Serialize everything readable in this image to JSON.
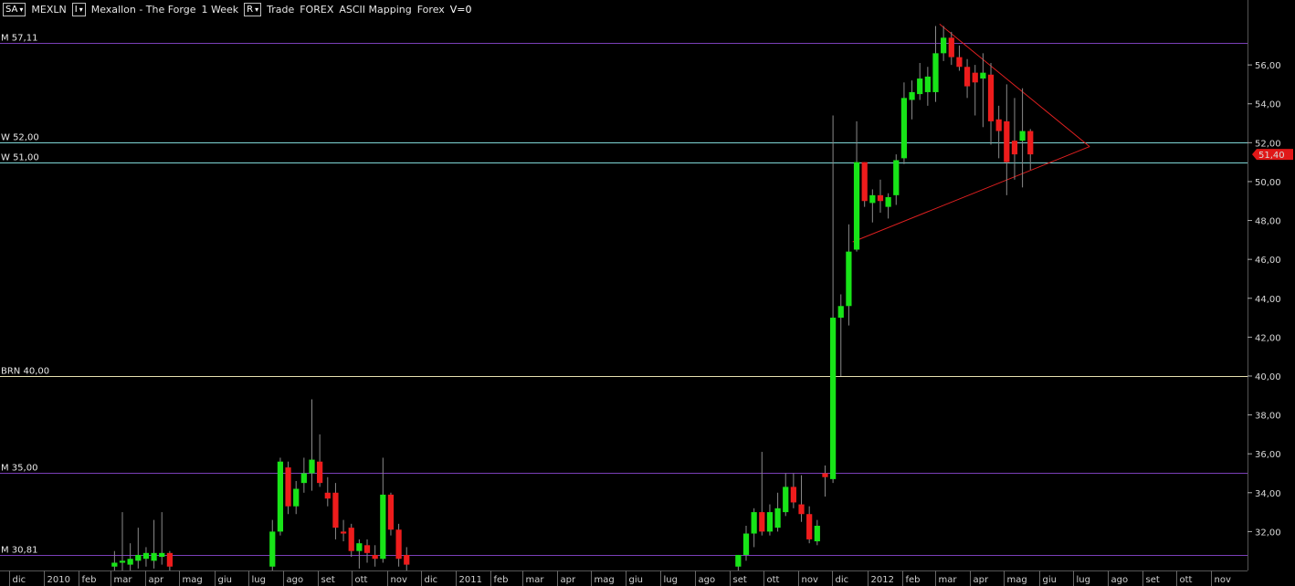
{
  "toolbar": {
    "source_box": "SA",
    "symbol": "MEXLN",
    "indicator_box": "I",
    "title": "Mexallon - The Forge",
    "period": "1 Week",
    "range_box": "R",
    "mode": "Trade",
    "market": "FOREX",
    "mapping": "ASCII Mapping",
    "category": "Forex",
    "volume": "V=0"
  },
  "colors": {
    "background": "#000000",
    "up_candle": "#18e418",
    "down_candle": "#ee1c1c",
    "wick": "#8a8a8a",
    "monthly_level": "#7a3fb8",
    "weekly_level": "#7fd6d6",
    "round_number_level": "#e6e0b0",
    "trendline": "#e02020",
    "price_tag": "#e01818"
  },
  "price_tag": {
    "label": "51,40",
    "value": 51.4
  },
  "chart_data": {
    "type": "candlestick",
    "ylim": [
      30.0,
      58.4
    ],
    "y_ticks": [
      {
        "value": 32,
        "label": "32,00"
      },
      {
        "value": 34,
        "label": "34,00"
      },
      {
        "value": 36,
        "label": "36,00"
      },
      {
        "value": 38,
        "label": "38,00"
      },
      {
        "value": 40,
        "label": "40,00"
      },
      {
        "value": 42,
        "label": "42,00"
      },
      {
        "value": 44,
        "label": "44,00"
      },
      {
        "value": 46,
        "label": "46,00"
      },
      {
        "value": 48,
        "label": "48,00"
      },
      {
        "value": 50,
        "label": "50,00"
      },
      {
        "value": 52,
        "label": "52,00"
      },
      {
        "value": 54,
        "label": "54,00"
      },
      {
        "value": 56,
        "label": "56,00"
      }
    ],
    "x_range": [
      "2009-11-23",
      "2012-12-03"
    ],
    "x_labels": [
      {
        "date": "2009-12-01",
        "label": "dic"
      },
      {
        "date": "2010-01-01",
        "label": "2010"
      },
      {
        "date": "2010-02-01",
        "label": "feb"
      },
      {
        "date": "2010-03-01",
        "label": "mar"
      },
      {
        "date": "2010-04-01",
        "label": "apr"
      },
      {
        "date": "2010-05-01",
        "label": "mag"
      },
      {
        "date": "2010-06-01",
        "label": "giu"
      },
      {
        "date": "2010-07-01",
        "label": "lug"
      },
      {
        "date": "2010-08-01",
        "label": "ago"
      },
      {
        "date": "2010-09-01",
        "label": "set"
      },
      {
        "date": "2010-10-01",
        "label": "ott"
      },
      {
        "date": "2010-11-01",
        "label": "nov"
      },
      {
        "date": "2010-12-01",
        "label": "dic"
      },
      {
        "date": "2011-01-01",
        "label": "2011"
      },
      {
        "date": "2011-02-01",
        "label": "feb"
      },
      {
        "date": "2011-03-01",
        "label": "mar"
      },
      {
        "date": "2011-04-01",
        "label": "apr"
      },
      {
        "date": "2011-05-01",
        "label": "mag"
      },
      {
        "date": "2011-06-01",
        "label": "giu"
      },
      {
        "date": "2011-07-01",
        "label": "lug"
      },
      {
        "date": "2011-08-01",
        "label": "ago"
      },
      {
        "date": "2011-09-01",
        "label": "set"
      },
      {
        "date": "2011-10-01",
        "label": "ott"
      },
      {
        "date": "2011-11-01",
        "label": "nov"
      },
      {
        "date": "2011-12-01",
        "label": "dic"
      },
      {
        "date": "2012-01-01",
        "label": "2012"
      },
      {
        "date": "2012-02-01",
        "label": "feb"
      },
      {
        "date": "2012-03-01",
        "label": "mar"
      },
      {
        "date": "2012-04-01",
        "label": "apr"
      },
      {
        "date": "2012-05-01",
        "label": "mag"
      },
      {
        "date": "2012-06-01",
        "label": "giu"
      },
      {
        "date": "2012-07-01",
        "label": "lug"
      },
      {
        "date": "2012-08-01",
        "label": "ago"
      },
      {
        "date": "2012-09-01",
        "label": "set"
      },
      {
        "date": "2012-10-01",
        "label": "ott"
      },
      {
        "date": "2012-11-01",
        "label": "nov"
      }
    ],
    "levels": [
      {
        "label": "M 57,11",
        "value": 57.11,
        "kind": "monthly"
      },
      {
        "label": "W 52,00",
        "value": 52.0,
        "kind": "weekly"
      },
      {
        "label": "W 51,00",
        "value": 51.0,
        "kind": "weekly"
      },
      {
        "label": "BRN 40,00",
        "value": 40.0,
        "kind": "round_number"
      },
      {
        "label": "M 35,00",
        "value": 35.0,
        "kind": "monthly"
      },
      {
        "label": "M 30,81",
        "value": 30.81,
        "kind": "monthly"
      }
    ],
    "trendlines": [
      {
        "from": {
          "date": "2012-03-05",
          "value": 58.1
        },
        "to": {
          "date": "2012-07-16",
          "value": 51.8
        }
      },
      {
        "from": {
          "date": "2011-12-19",
          "value": 46.9
        },
        "to": {
          "date": "2012-07-16",
          "value": 51.8
        }
      }
    ],
    "candles": [
      {
        "date": "2010-03-01",
        "open": 30.2,
        "high": 31.0,
        "low": 29.8,
        "close": 30.4
      },
      {
        "date": "2010-03-08",
        "open": 30.4,
        "high": 33.0,
        "low": 30.0,
        "close": 30.5
      },
      {
        "date": "2010-03-15",
        "open": 30.3,
        "high": 31.4,
        "low": 30.0,
        "close": 30.6
      },
      {
        "date": "2010-03-22",
        "open": 30.5,
        "high": 32.2,
        "low": 30.1,
        "close": 30.8
      },
      {
        "date": "2010-03-29",
        "open": 30.6,
        "high": 31.2,
        "low": 30.2,
        "close": 30.9
      },
      {
        "date": "2010-04-05",
        "open": 30.5,
        "high": 32.6,
        "low": 30.1,
        "close": 30.9
      },
      {
        "date": "2010-04-12",
        "open": 30.7,
        "high": 33.0,
        "low": 30.3,
        "close": 30.9
      },
      {
        "date": "2010-04-19",
        "open": 30.9,
        "high": 31.0,
        "low": 30.0,
        "close": 30.2
      },
      {
        "date": "2010-07-19",
        "open": 30.2,
        "high": 32.6,
        "low": 30.0,
        "close": 32.0
      },
      {
        "date": "2010-07-26",
        "open": 32.0,
        "high": 35.8,
        "low": 31.8,
        "close": 35.6
      },
      {
        "date": "2010-08-02",
        "open": 35.3,
        "high": 35.6,
        "low": 32.9,
        "close": 33.3
      },
      {
        "date": "2010-08-09",
        "open": 33.3,
        "high": 34.6,
        "low": 32.9,
        "close": 34.2
      },
      {
        "date": "2010-08-16",
        "open": 34.5,
        "high": 35.8,
        "low": 34.0,
        "close": 35.0
      },
      {
        "date": "2010-08-23",
        "open": 35.0,
        "high": 38.8,
        "low": 34.1,
        "close": 35.7
      },
      {
        "date": "2010-08-30",
        "open": 35.6,
        "high": 37.0,
        "low": 34.3,
        "close": 34.5
      },
      {
        "date": "2010-09-06",
        "open": 34.0,
        "high": 34.8,
        "low": 33.3,
        "close": 33.7
      },
      {
        "date": "2010-09-13",
        "open": 34.0,
        "high": 34.5,
        "low": 31.6,
        "close": 32.2
      },
      {
        "date": "2010-09-20",
        "open": 32.0,
        "high": 32.6,
        "low": 31.5,
        "close": 31.9
      },
      {
        "date": "2010-09-27",
        "open": 32.2,
        "high": 32.4,
        "low": 30.7,
        "close": 31.0
      },
      {
        "date": "2010-10-04",
        "open": 31.0,
        "high": 31.6,
        "low": 30.1,
        "close": 31.4
      },
      {
        "date": "2010-10-11",
        "open": 31.3,
        "high": 31.6,
        "low": 30.4,
        "close": 30.9
      },
      {
        "date": "2010-10-18",
        "open": 30.8,
        "high": 31.3,
        "low": 30.2,
        "close": 30.6
      },
      {
        "date": "2010-10-25",
        "open": 30.6,
        "high": 35.8,
        "low": 30.4,
        "close": 33.9
      },
      {
        "date": "2010-11-01",
        "open": 33.9,
        "high": 34.0,
        "low": 31.8,
        "close": 32.1
      },
      {
        "date": "2010-11-08",
        "open": 32.1,
        "high": 32.4,
        "low": 30.2,
        "close": 30.6
      },
      {
        "date": "2010-11-15",
        "open": 30.8,
        "high": 31.2,
        "low": 30.0,
        "close": 30.3
      },
      {
        "date": "2011-09-05",
        "open": 30.2,
        "high": 30.8,
        "low": 29.8,
        "close": 30.8
      },
      {
        "date": "2011-09-12",
        "open": 30.8,
        "high": 32.3,
        "low": 30.5,
        "close": 31.9
      },
      {
        "date": "2011-09-19",
        "open": 31.9,
        "high": 33.2,
        "low": 31.2,
        "close": 33.0
      },
      {
        "date": "2011-09-26",
        "open": 33.0,
        "high": 36.1,
        "low": 31.8,
        "close": 32.0
      },
      {
        "date": "2011-10-03",
        "open": 32.0,
        "high": 33.4,
        "low": 31.8,
        "close": 33.0
      },
      {
        "date": "2011-10-10",
        "open": 32.2,
        "high": 34.0,
        "low": 32.0,
        "close": 33.2
      },
      {
        "date": "2011-10-17",
        "open": 33.0,
        "high": 35.0,
        "low": 32.8,
        "close": 34.3
      },
      {
        "date": "2011-10-24",
        "open": 34.3,
        "high": 35.0,
        "low": 33.2,
        "close": 33.5
      },
      {
        "date": "2011-10-31",
        "open": 33.4,
        "high": 34.9,
        "low": 32.5,
        "close": 32.9
      },
      {
        "date": "2011-11-07",
        "open": 32.9,
        "high": 33.3,
        "low": 31.4,
        "close": 31.6
      },
      {
        "date": "2011-11-14",
        "open": 31.5,
        "high": 32.6,
        "low": 31.3,
        "close": 32.3
      },
      {
        "date": "2011-11-21",
        "open": 35.0,
        "high": 35.4,
        "low": 33.8,
        "close": 34.8
      },
      {
        "date": "2011-11-28",
        "open": 34.7,
        "high": 53.4,
        "low": 34.5,
        "close": 43.0
      },
      {
        "date": "2011-12-05",
        "open": 43.0,
        "high": 44.2,
        "low": 40.0,
        "close": 43.6
      },
      {
        "date": "2011-12-12",
        "open": 43.6,
        "high": 47.8,
        "low": 42.6,
        "close": 46.4
      },
      {
        "date": "2011-12-19",
        "open": 46.5,
        "high": 53.1,
        "low": 46.4,
        "close": 51.0
      },
      {
        "date": "2011-12-26",
        "open": 51.0,
        "high": 51.0,
        "low": 48.7,
        "close": 49.0
      },
      {
        "date": "2012-01-02",
        "open": 48.9,
        "high": 49.6,
        "low": 47.9,
        "close": 49.3
      },
      {
        "date": "2012-01-09",
        "open": 49.3,
        "high": 50.1,
        "low": 48.4,
        "close": 49.0
      },
      {
        "date": "2012-01-16",
        "open": 48.7,
        "high": 49.4,
        "low": 48.1,
        "close": 49.2
      },
      {
        "date": "2012-01-23",
        "open": 49.3,
        "high": 51.4,
        "low": 48.8,
        "close": 51.1
      },
      {
        "date": "2012-01-30",
        "open": 51.2,
        "high": 55.1,
        "low": 50.9,
        "close": 54.3
      },
      {
        "date": "2012-02-06",
        "open": 54.2,
        "high": 55.2,
        "low": 53.2,
        "close": 54.6
      },
      {
        "date": "2012-02-13",
        "open": 54.5,
        "high": 56.1,
        "low": 54.2,
        "close": 55.3
      },
      {
        "date": "2012-02-20",
        "open": 54.6,
        "high": 55.9,
        "low": 53.9,
        "close": 55.4
      },
      {
        "date": "2012-02-27",
        "open": 54.6,
        "high": 58.0,
        "low": 54.1,
        "close": 56.6
      },
      {
        "date": "2012-03-05",
        "open": 56.6,
        "high": 58.0,
        "low": 56.2,
        "close": 57.4
      },
      {
        "date": "2012-03-12",
        "open": 57.4,
        "high": 57.7,
        "low": 56.0,
        "close": 56.4
      },
      {
        "date": "2012-03-19",
        "open": 56.4,
        "high": 57.0,
        "low": 55.7,
        "close": 55.9
      },
      {
        "date": "2012-03-26",
        "open": 55.9,
        "high": 56.3,
        "low": 54.3,
        "close": 54.9
      },
      {
        "date": "2012-04-02",
        "open": 55.6,
        "high": 56.0,
        "low": 53.4,
        "close": 55.1
      },
      {
        "date": "2012-04-09",
        "open": 55.3,
        "high": 56.6,
        "low": 52.8,
        "close": 55.6
      },
      {
        "date": "2012-04-16",
        "open": 55.5,
        "high": 56.1,
        "low": 51.9,
        "close": 53.1
      },
      {
        "date": "2012-04-23",
        "open": 53.2,
        "high": 53.9,
        "low": 51.2,
        "close": 52.6
      },
      {
        "date": "2012-04-30",
        "open": 53.1,
        "high": 55.0,
        "low": 49.3,
        "close": 51.0
      },
      {
        "date": "2012-05-07",
        "open": 52.1,
        "high": 54.3,
        "low": 50.1,
        "close": 51.4
      },
      {
        "date": "2012-05-14",
        "open": 52.1,
        "high": 54.8,
        "low": 49.7,
        "close": 52.6
      },
      {
        "date": "2012-05-21",
        "open": 52.6,
        "high": 52.7,
        "low": 50.6,
        "close": 51.4
      }
    ]
  }
}
